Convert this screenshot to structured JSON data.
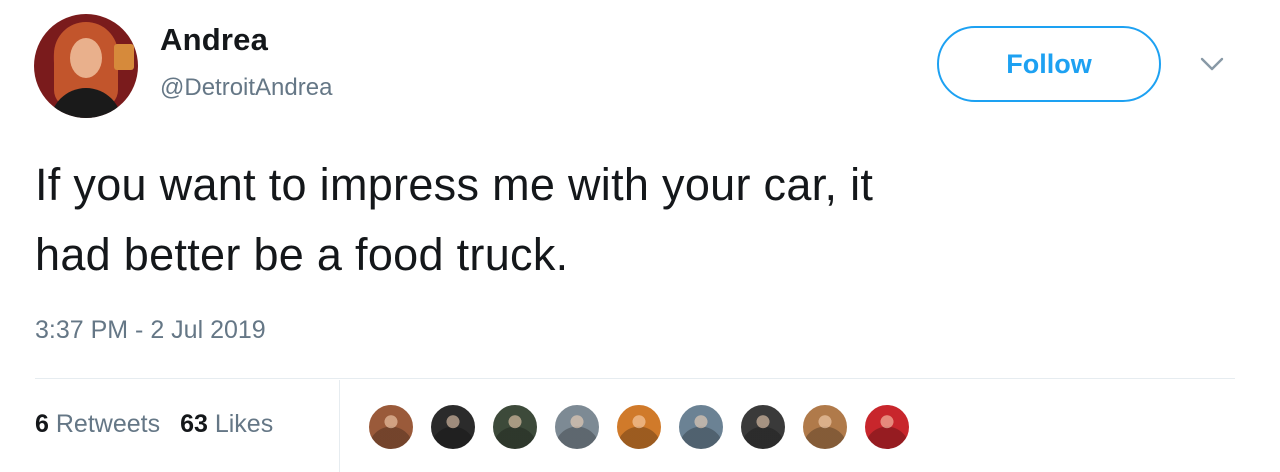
{
  "user": {
    "display_name": "Andrea",
    "handle": "@DetroitAndrea"
  },
  "actions": {
    "follow_label": "Follow",
    "more_icon": "chevron-down-icon"
  },
  "tweet": {
    "text_line1": "If you want to impress me with your car, it",
    "text_line2": "had better be a food truck.",
    "timestamp": "3:37 PM - 2 Jul 2019"
  },
  "stats": {
    "retweets_count": "6",
    "retweets_label": "Retweets",
    "likes_count": "63",
    "likes_label": "Likes"
  },
  "likers": [
    {
      "name": "liker-1",
      "color": "#9a5a3a"
    },
    {
      "name": "liker-2",
      "color": "#2b2b2b"
    },
    {
      "name": "liker-3",
      "color": "#3d4a3a"
    },
    {
      "name": "liker-4",
      "color": "#7d8a94"
    },
    {
      "name": "liker-5",
      "color": "#d07a2a"
    },
    {
      "name": "liker-6",
      "color": "#6b8294"
    },
    {
      "name": "liker-7",
      "color": "#3a3a3a"
    },
    {
      "name": "liker-8",
      "color": "#b07a4a"
    },
    {
      "name": "liker-9",
      "color": "#c8262c"
    }
  ],
  "colors": {
    "accent": "#1da1f2",
    "text_primary": "#14171a",
    "text_secondary": "#657786",
    "divider": "#e6ecf0"
  }
}
